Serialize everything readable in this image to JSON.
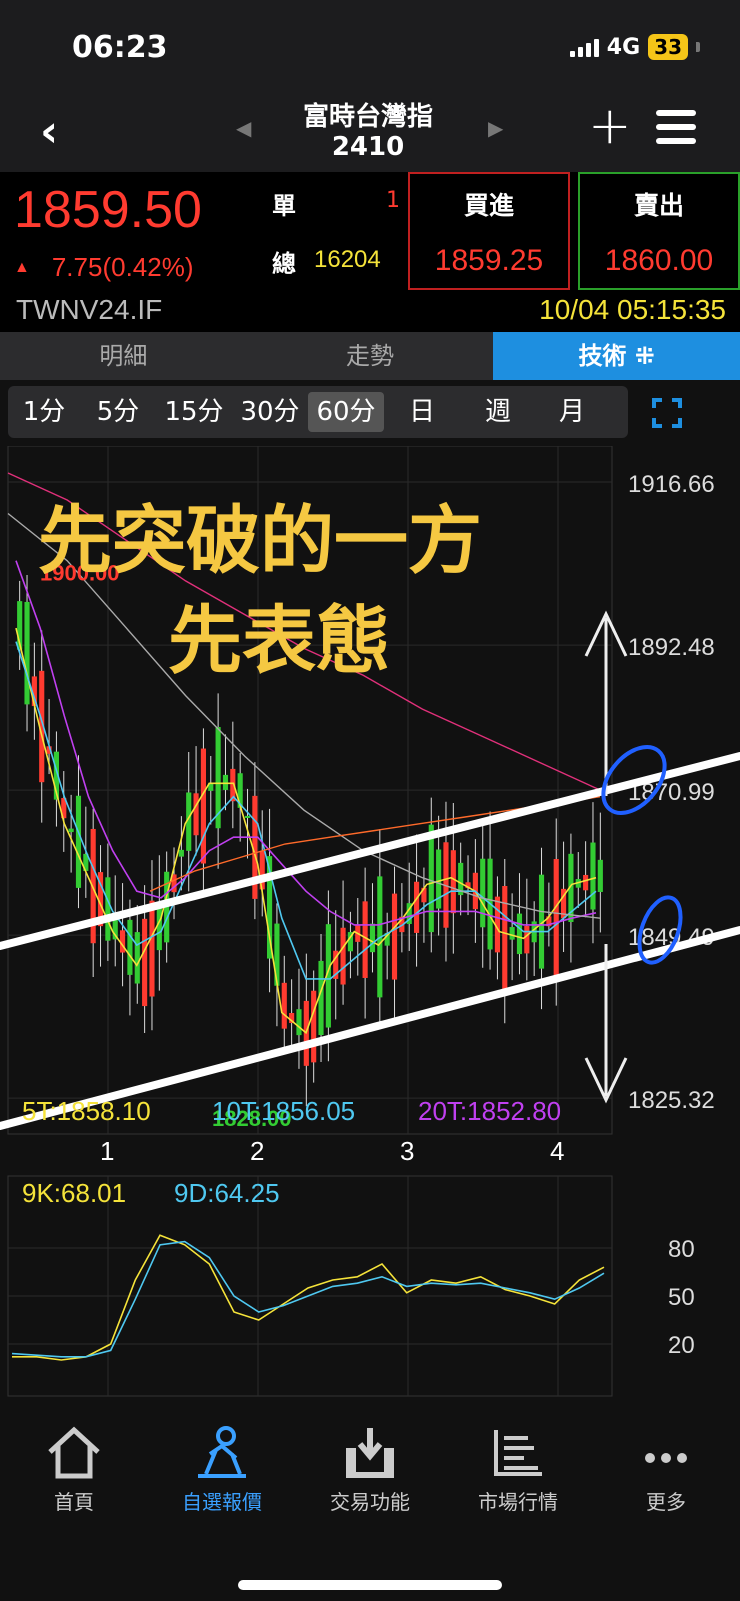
{
  "status": {
    "time": "06:23",
    "network": "4G",
    "battery": "33"
  },
  "nav": {
    "title": "富時台灣指",
    "subtitle": "2410"
  },
  "quote": {
    "price": "1859.50",
    "change": "7.75(0.42%)",
    "single_label": "單",
    "single_value": "1",
    "total_label": "總",
    "total_value": "16204",
    "buy_label": "買進",
    "buy_value": "1859.25",
    "sell_label": "賣出",
    "sell_value": "1860.00",
    "code": "TWNV24.IF",
    "datetime": "10/04 05:15:35"
  },
  "tabs": [
    "明細",
    "走勢",
    "技術 ⁜"
  ],
  "active_tab": 2,
  "periods": [
    "1分",
    "5分",
    "15分",
    "30分",
    "60分",
    "日",
    "週",
    "月"
  ],
  "active_period": 4,
  "chart_data": [
    {
      "type": "candlestick",
      "title": "",
      "annotation_lines": [
        "先突破的一方",
        "先表態"
      ],
      "y_ticks": [
        "1916.66",
        "1892.48",
        "1870.99",
        "1849.49",
        "1825.32"
      ],
      "y_range": [
        1825.32,
        1916.66
      ],
      "x_ticks": [
        "1",
        "2",
        "3",
        "4"
      ],
      "high_label": "1900.00",
      "low_label": "1828.00",
      "ma_labels": [
        {
          "name": "5T",
          "value": "1858.10",
          "color": "#f5e33a"
        },
        {
          "name": "10T",
          "value": "1856.05",
          "color": "#4fc8f0"
        },
        {
          "name": "20T",
          "value": "1852.80",
          "color": "#c040f0"
        }
      ],
      "series": [
        {
          "name": "5T",
          "values": [
            1895,
            1880,
            1866,
            1858,
            1850,
            1845,
            1852,
            1866,
            1872,
            1872,
            1860,
            1838,
            1835,
            1845,
            1850,
            1848,
            1852,
            1857,
            1858,
            1856,
            1850,
            1849,
            1852,
            1857,
            1858
          ]
        },
        {
          "name": "10T",
          "values": [
            1893,
            1882,
            1870,
            1861,
            1853,
            1848,
            1850,
            1858,
            1866,
            1870,
            1866,
            1852,
            1843,
            1843,
            1846,
            1849,
            1851,
            1854,
            1856,
            1856,
            1853,
            1850,
            1850,
            1853,
            1856
          ]
        },
        {
          "name": "20T",
          "values": [
            1905,
            1895,
            1882,
            1870,
            1862,
            1856,
            1855,
            1858,
            1862,
            1864,
            1864,
            1860,
            1856,
            1853,
            1851,
            1851,
            1852,
            1853,
            1853,
            1853,
            1852,
            1851,
            1851,
            1852,
            1852.8
          ]
        }
      ]
    },
    {
      "type": "line",
      "title": "",
      "y_ticks": [
        "80",
        "50",
        "20"
      ],
      "y_range": [
        0,
        100
      ],
      "labels": [
        {
          "name": "9K",
          "value": "68.01",
          "color": "#f5e33a"
        },
        {
          "name": "9D",
          "value": "64.25",
          "color": "#4fc8f0"
        }
      ],
      "series": [
        {
          "name": "9K",
          "values": [
            12,
            12,
            10,
            12,
            20,
            60,
            88,
            82,
            70,
            40,
            35,
            45,
            55,
            60,
            62,
            70,
            52,
            60,
            58,
            62,
            54,
            50,
            45,
            60,
            68.01
          ]
        },
        {
          "name": "9D",
          "values": [
            14,
            13,
            12,
            12,
            16,
            48,
            82,
            84,
            74,
            50,
            40,
            44,
            50,
            56,
            58,
            62,
            56,
            58,
            57,
            58,
            55,
            52,
            48,
            55,
            64.25
          ]
        }
      ]
    }
  ],
  "bottom_nav": [
    {
      "label": "首頁",
      "icon": "home-icon"
    },
    {
      "label": "自選報價",
      "icon": "watchlist-icon"
    },
    {
      "label": "交易功能",
      "icon": "trade-icon"
    },
    {
      "label": "市場行情",
      "icon": "market-icon"
    },
    {
      "label": "更多",
      "icon": "more-icon"
    }
  ],
  "active_bottom": 1
}
